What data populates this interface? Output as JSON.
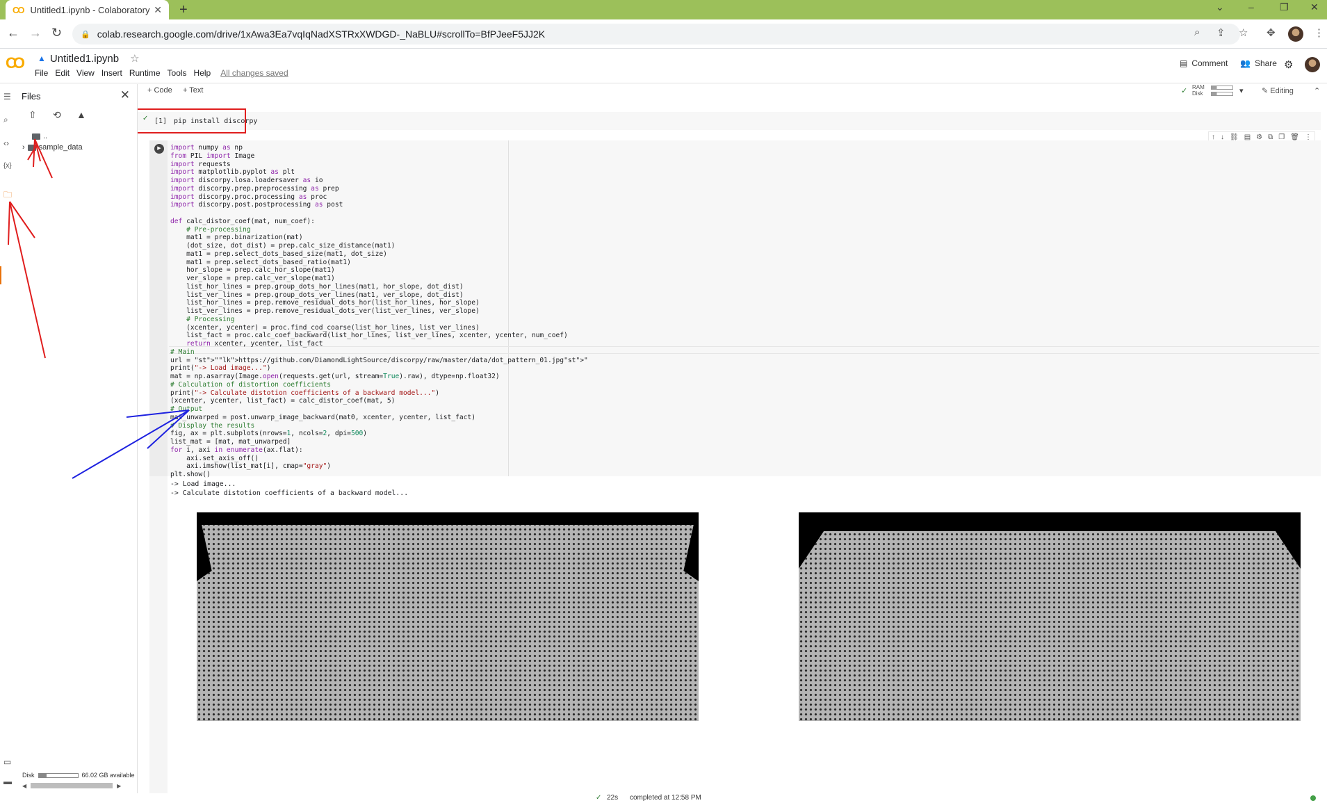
{
  "browser": {
    "tab_title": "Untitled1.ipynb - Colaboratory",
    "favicon": "CO",
    "url": "colab.research.google.com/drive/1xAwa3Ea7vqIqNadXSTRxXWDGD-_NaBLU#scrollTo=BfPJeeF5JJ2K"
  },
  "header": {
    "logo": "CO",
    "notebook_name": "Untitled1.ipynb",
    "menu": [
      "File",
      "Edit",
      "View",
      "Insert",
      "Runtime",
      "Tools",
      "Help"
    ],
    "save_status": "All changes saved",
    "comment_label": "Comment",
    "share_label": "Share"
  },
  "files_panel": {
    "title": "Files",
    "parent_item": "..",
    "folder": "sample_data",
    "disk_label": "Disk",
    "disk_available": "66.02 GB available"
  },
  "toolbar": {
    "add_code": "+ Code",
    "add_text": "+ Text",
    "ram_label": "RAM",
    "disk_label": "Disk",
    "editing": "Editing"
  },
  "cell1": {
    "exec_count": "[1]",
    "code": "pip install discorpy"
  },
  "cell2": {
    "lines": [
      "import numpy as np",
      "from PIL import Image",
      "import requests",
      "import matplotlib.pyplot as plt",
      "import discorpy.losa.loadersaver as io",
      "import discorpy.prep.preprocessing as prep",
      "import discorpy.proc.processing as proc",
      "import discorpy.post.postprocessing as post",
      "",
      "def calc_distor_coef(mat, num_coef):",
      "    # Pre-processing",
      "    mat1 = prep.binarization(mat)",
      "    (dot_size, dot_dist) = prep.calc_size_distance(mat1)",
      "    mat1 = prep.select_dots_based_size(mat1, dot_size)",
      "    mat1 = prep.select_dots_based_ratio(mat1)",
      "    hor_slope = prep.calc_hor_slope(mat1)",
      "    ver_slope = prep.calc_ver_slope(mat1)",
      "    list_hor_lines = prep.group_dots_hor_lines(mat1, hor_slope, dot_dist)",
      "    list_ver_lines = prep.group_dots_ver_lines(mat1, ver_slope, dot_dist)",
      "    list_hor_lines = prep.remove_residual_dots_hor(list_hor_lines, hor_slope)",
      "    list_ver_lines = prep.remove_residual_dots_ver(list_ver_lines, ver_slope)",
      "    # Processing",
      "    (xcenter, ycenter) = proc.find_cod_coarse(list_hor_lines, list_ver_lines)",
      "    list_fact = proc.calc_coef_backward(list_hor_lines, list_ver_lines, xcenter, ycenter, num_coef)",
      "    return xcenter, ycenter, list_fact",
      "# Main",
      "url = \"https://github.com/DiamondLightSource/discorpy/raw/master/data/dot_pattern_01.jpg\"",
      "print(\"-> Load image...\")",
      "mat = np.asarray(Image.open(requests.get(url, stream=True).raw), dtype=np.float32)",
      "# Calculation of distortion coefficients",
      "print(\"-> Calculate distotion coefficients of a backward model...\")",
      "(xcenter, ycenter, list_fact) = calc_distor_coef(mat, 5)",
      "# Output",
      "mat_unwarped = post.unwarp_image_backward(mat0, xcenter, ycenter, list_fact)",
      "# Display the results",
      "fig, ax = plt.subplots(nrows=1, ncols=2, dpi=500)",
      "list_mat = [mat, mat_unwarped]",
      "for i, axi in enumerate(ax.flat):",
      "    axi.set_axis_off()",
      "    axi.imshow(list_mat[i], cmap=\"gray\")",
      "plt.show()"
    ],
    "output": [
      "-> Load image...",
      "-> Calculate distotion coefficients of a backward model..."
    ]
  },
  "status": {
    "check": "✓",
    "duration": "22s",
    "completed": "completed at 12:58 PM"
  },
  "colors": {
    "chrome_frame": "#9cc05a",
    "annotation_red": "#e01e1e",
    "annotation_blue": "#1e22e0",
    "colab_orange": "#f9ab00"
  }
}
